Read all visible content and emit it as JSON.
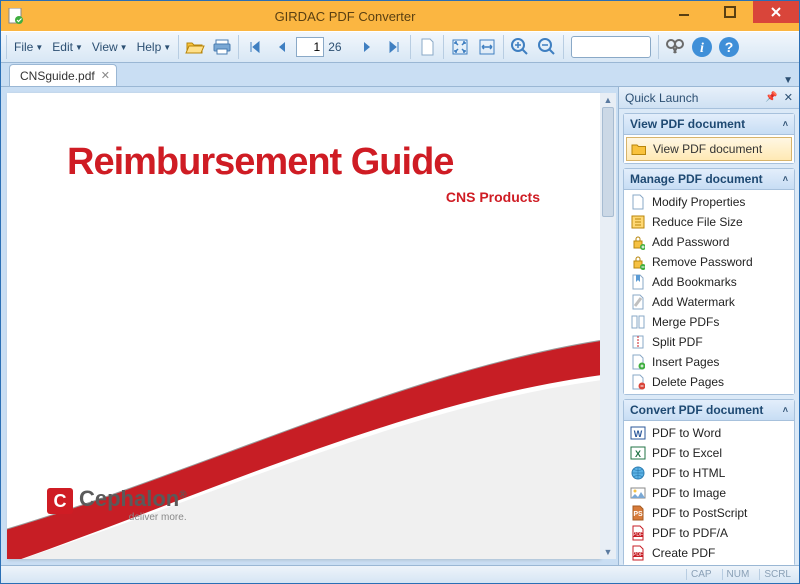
{
  "window": {
    "title": "GIRDAC PDF Converter"
  },
  "menus": {
    "file": "File",
    "edit": "Edit",
    "view": "View",
    "help": "Help"
  },
  "toolbar": {
    "current_page": "1",
    "total_pages": "26"
  },
  "tab": {
    "label": "CNSguide.pdf"
  },
  "document": {
    "title": "Reimbursement Guide",
    "subtitle": "CNS Products",
    "logo_name": "Cephalon",
    "logo_tagline": "deliver more.",
    "logo_mark_letter": "C"
  },
  "sidepanel": {
    "header": "Quick Launch",
    "sections": {
      "view": {
        "title": "View PDF document",
        "item": "View PDF document"
      },
      "manage": {
        "title": "Manage PDF document",
        "items": [
          "Modify Properties",
          "Reduce File Size",
          "Add Password",
          "Remove Password",
          "Add Bookmarks",
          "Add Watermark",
          "Merge PDFs",
          "Split PDF",
          "Insert Pages",
          "Delete Pages"
        ]
      },
      "convert": {
        "title": "Convert PDF document",
        "items": [
          "PDF to Word",
          "PDF to Excel",
          "PDF to HTML",
          "PDF to Image",
          "PDF to PostScript",
          "PDF to PDF/A",
          "Create PDF"
        ]
      }
    }
  },
  "statusbar": {
    "cap": "CAP",
    "num": "NUM",
    "scrl": "SCRL"
  }
}
